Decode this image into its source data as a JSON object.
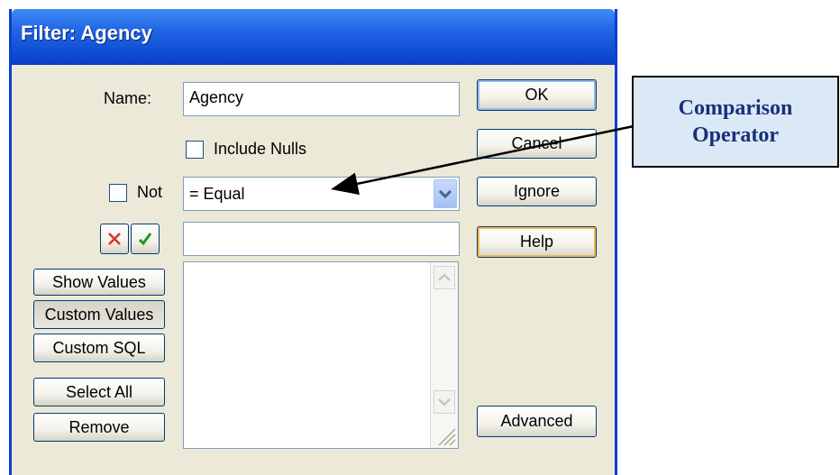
{
  "window": {
    "title": "Filter: Agency"
  },
  "form": {
    "name_label": "Name:",
    "name_value": "Agency",
    "include_nulls_label": "Include Nulls",
    "include_nulls_checked": false,
    "not_label": "Not",
    "not_checked": false,
    "operator_value": "= Equal",
    "value_input": ""
  },
  "buttons": {
    "ok": "OK",
    "cancel": "Cancel",
    "ignore": "Ignore",
    "help": "Help",
    "advanced": "Advanced",
    "show_values": "Show Values",
    "custom_values": "Custom Values",
    "custom_sql": "Custom SQL",
    "select_all": "Select All",
    "remove": "Remove"
  },
  "icons": {
    "reject": "red-x-icon",
    "accept": "green-check-icon"
  },
  "annotation": {
    "line1": "Comparison",
    "line2": "Operator"
  }
}
